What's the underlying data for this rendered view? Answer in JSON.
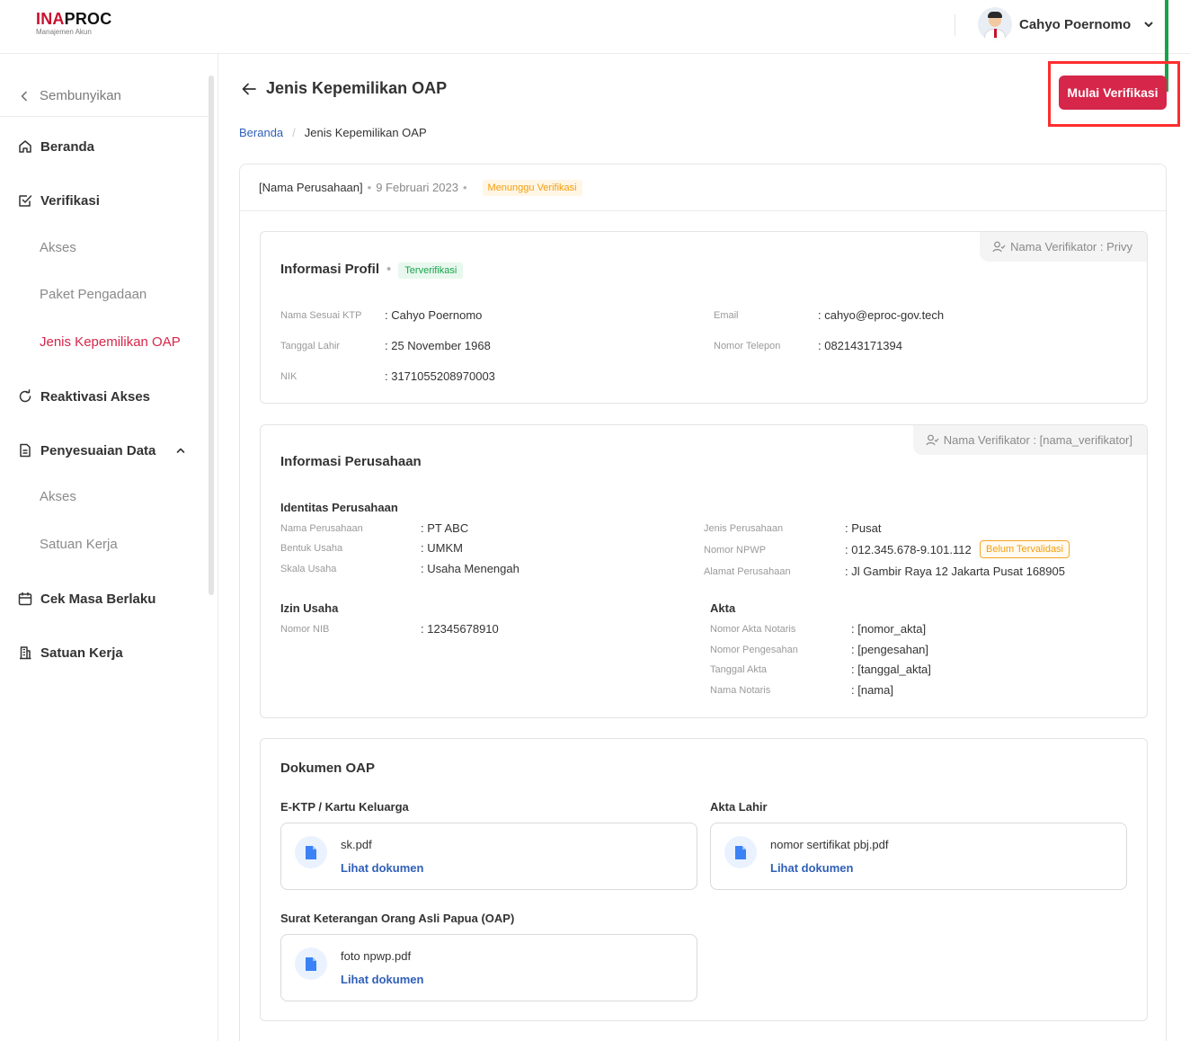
{
  "app": {
    "logo_ina": "INA",
    "logo_proc": "PROC",
    "logo_sub": "Manajemen Akun",
    "user_name": "Cahyo Poernomo"
  },
  "sidebar": {
    "hide_label": "Sembunyikan",
    "items": [
      {
        "label": "Beranda",
        "icon": "home-icon"
      },
      {
        "label": "Verifikasi",
        "icon": "checkbox-icon"
      },
      {
        "label": "Akses"
      },
      {
        "label": "Paket Pengadaan"
      },
      {
        "label": "Jenis Kepemilikan OAP"
      },
      {
        "label": "Reaktivasi Akses",
        "icon": "refresh-icon"
      },
      {
        "label": "Penyesuaian Data",
        "icon": "document-icon"
      },
      {
        "label": "Akses"
      },
      {
        "label": "Satuan Kerja"
      },
      {
        "label": "Cek Masa Berlaku",
        "icon": "calendar-icon"
      },
      {
        "label": "Satuan Kerja",
        "icon": "building-icon"
      }
    ]
  },
  "page": {
    "title": "Jenis Kepemilikan OAP",
    "primary_button": "Mulai Verifikasi",
    "breadcrumb": {
      "home": "Beranda",
      "separator": "/",
      "current": "Jenis Kepemilikan OAP"
    },
    "colors": {
      "accent": "#d6264a",
      "link": "#2f5fb8",
      "success": "#16a34a",
      "warning": "#f59e0b",
      "highlight": "#ff2d2d"
    }
  },
  "submission": {
    "company": "[Nama Perusahaan]",
    "dot": "•",
    "date": "9 Februari 2023",
    "status": "Menunggu Verifikasi"
  },
  "profile": {
    "title": "Informasi Profil",
    "dot": "•",
    "status": "Terverifikasi",
    "verifier": "Nama Verifikator : Privy",
    "fields": [
      {
        "label": "Nama Sesuai KTP",
        "value": ": Cahyo Poernomo"
      },
      {
        "label": "Tanggal Lahir",
        "value": ": 25 November 1968"
      },
      {
        "label": "NIK",
        "value": ": 3171055208970003"
      },
      {
        "label": "Email",
        "value": ": cahyo@eproc-gov.tech"
      },
      {
        "label": "Nomor Telepon",
        "value": ": 082143171394"
      }
    ]
  },
  "company": {
    "title": "Informasi Perusahaan",
    "verifier": "Nama Verifikator : [nama_verifikator]",
    "identity": {
      "title": "Identitas Perusahaan",
      "left": [
        {
          "label": "Nama Perusahaan",
          "value": ": PT ABC"
        },
        {
          "label": "Bentuk Usaha",
          "value": ": UMKM"
        },
        {
          "label": "Skala Usaha",
          "value": ": Usaha Menengah"
        }
      ],
      "right": [
        {
          "label": "Jenis Perusahaan",
          "value": ": Pusat"
        },
        {
          "label": "Nomor NPWP",
          "value": ": 012.345.678-9.101.112"
        },
        {
          "label": "Alamat Perusahaan",
          "value": ": Jl Gambir Raya 12 Jakarta Pusat 168905"
        }
      ],
      "npwp_badge": "Belum Tervalidasi"
    },
    "izin": {
      "title": "Izin Usaha",
      "fields": [
        {
          "label": "Nomor NIB",
          "value": ": 12345678910"
        }
      ]
    },
    "akta": {
      "title": "Akta",
      "fields": [
        {
          "label": "Nomor Akta Notaris",
          "value": ": [nomor_akta]"
        },
        {
          "label": "Nomor Pengesahan",
          "value": ": [pengesahan]"
        },
        {
          "label": "Tanggal Akta",
          "value": ": [tanggal_akta]"
        },
        {
          "label": "Nama Notaris",
          "value": ": [nama]"
        }
      ]
    }
  },
  "documents": {
    "title": "Dokumen OAP",
    "items": [
      {
        "label": "E-KTP / Kartu Keluarga",
        "file": "sk.pdf",
        "link": "Lihat dokumen"
      },
      {
        "label": "Akta Lahir",
        "file": "nomor sertifikat pbj.pdf",
        "link": "Lihat dokumen"
      },
      {
        "label": "Surat Keterangan Orang Asli Papua (OAP)",
        "file": "foto npwp.pdf",
        "link": "Lihat dokumen"
      }
    ]
  }
}
